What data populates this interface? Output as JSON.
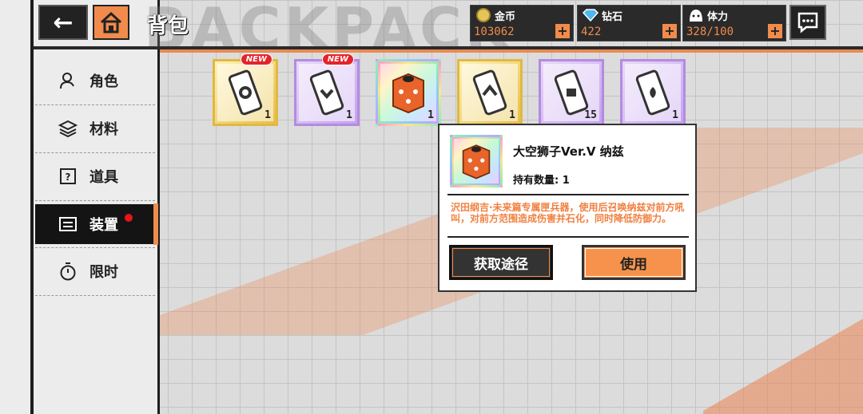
{
  "header": {
    "title": "背包",
    "title_bg": "BACKPACK",
    "back_glyph": "←"
  },
  "currencies": [
    {
      "name": "金币",
      "value": "103062",
      "icon": "coin-icon",
      "plus": "+"
    },
    {
      "name": "钻石",
      "value": "422",
      "icon": "diamond-icon",
      "plus": "+"
    },
    {
      "name": "体力",
      "value": "328/100",
      "icon": "stamina-icon",
      "plus": "+"
    }
  ],
  "sidebar": {
    "items": [
      {
        "label": "角色",
        "icon": "person-icon"
      },
      {
        "label": "材料",
        "icon": "layers-icon"
      },
      {
        "label": "道具",
        "icon": "mystery-box-icon"
      },
      {
        "label": "装置",
        "icon": "device-icon",
        "active": true,
        "badge": true
      },
      {
        "label": "限时",
        "icon": "timer-icon"
      }
    ]
  },
  "inventory": [
    {
      "count": "1",
      "rarity": "gold",
      "new": "NEW",
      "icon": "scroll-device-icon"
    },
    {
      "count": "1",
      "rarity": "purple",
      "new": "NEW",
      "icon": "scroll-device-icon"
    },
    {
      "count": "1",
      "rarity": "rainbow",
      "new": "",
      "icon": "lantern-box-icon"
    },
    {
      "count": "1",
      "rarity": "gold",
      "new": "",
      "icon": "scroll-device-icon"
    },
    {
      "count": "15",
      "rarity": "purple",
      "new": "",
      "icon": "scroll-device-icon"
    },
    {
      "count": "1",
      "rarity": "purple",
      "new": "",
      "icon": "scroll-device-icon"
    }
  ],
  "popup": {
    "name": "大空狮子Ver.V 纳兹",
    "qty_label": "持有数量: 1",
    "desc": "沢田纲吉·未来篇专属匣兵器，使用后召唤纳兹对前方吼叫，对前方范围造成伤害并石化，同时降低防御力。",
    "source_label": "获取途径",
    "use_label": "使用"
  },
  "colors": {
    "accent": "#f08b4c",
    "dark": "#222222",
    "badge": "#e8141b"
  }
}
